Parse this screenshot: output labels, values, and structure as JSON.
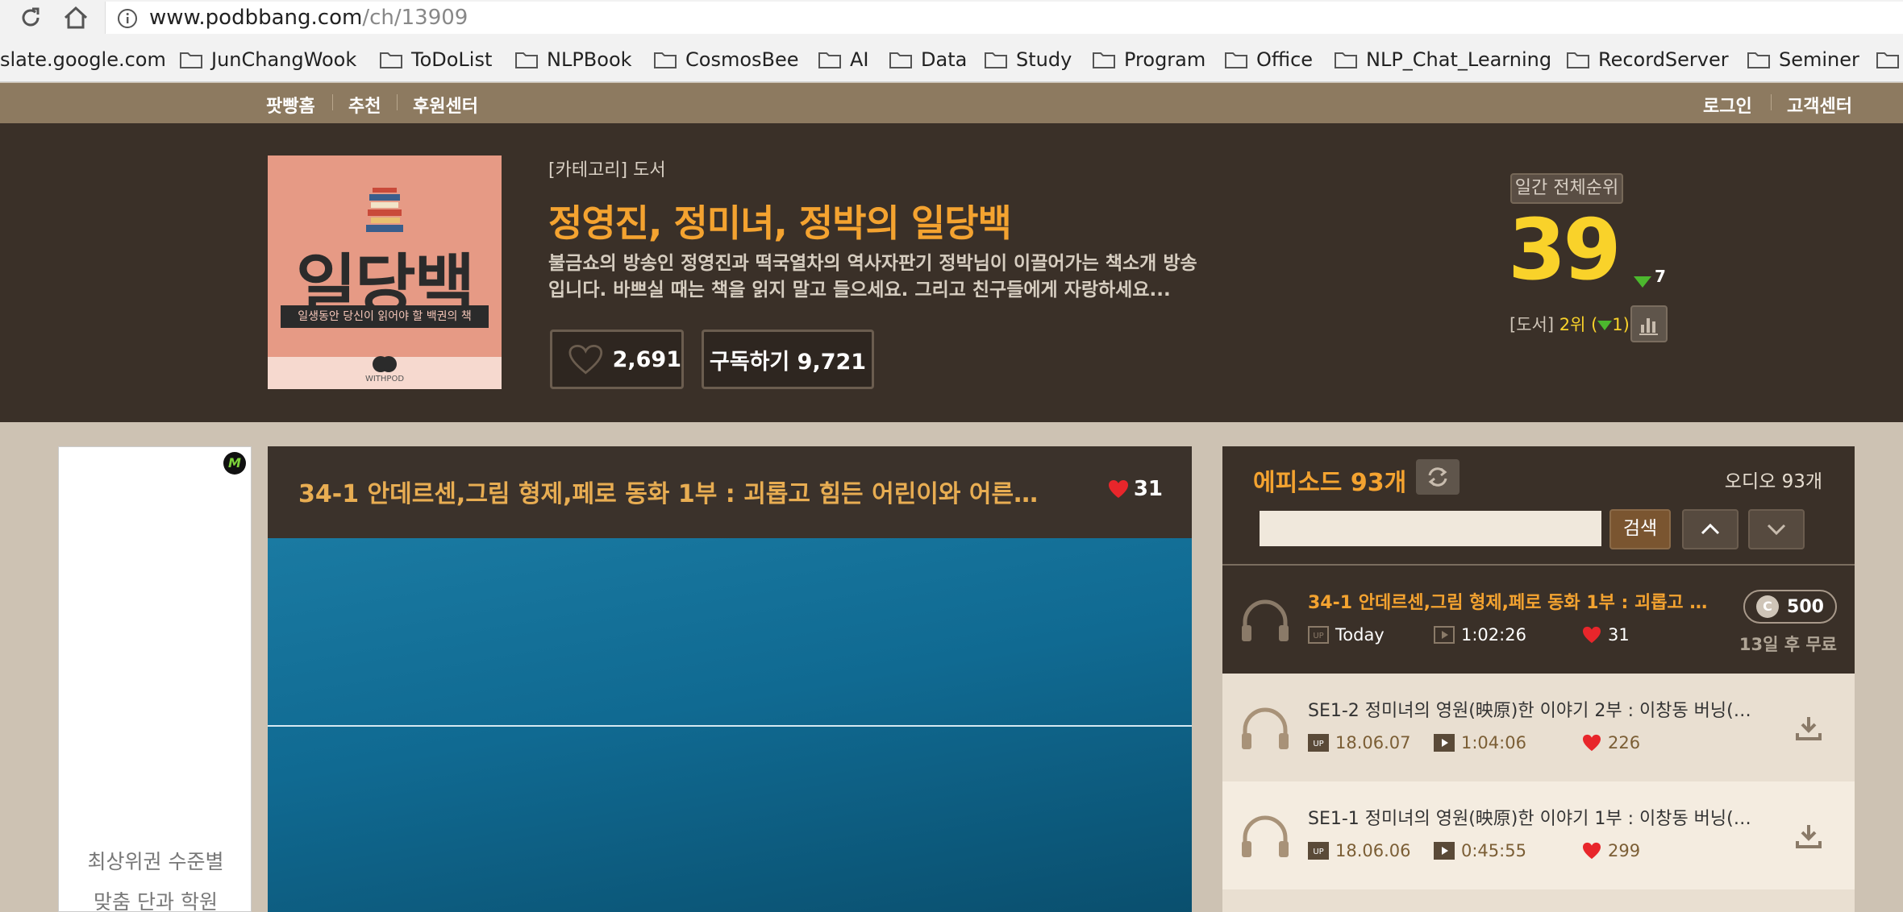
{
  "browser": {
    "url_host": "www.podbbang.com",
    "url_path": "/ch/13909",
    "bookmarks": [
      "slate.google.com",
      "JunChangWook",
      "ToDoList",
      "NLPBook",
      "CosmosBee",
      "AI",
      "Data",
      "Study",
      "Program",
      "Office",
      "NLP_Chat_Learning",
      "RecordServer",
      "Seminer"
    ]
  },
  "nav": {
    "home": "팟빵홈",
    "recommend": "추천",
    "sponsor": "후원센터",
    "login": "로그인",
    "support": "고객센터"
  },
  "channel": {
    "cover_title": "일당백",
    "cover_subtitle": "일생동안 당신이 읽어야 할 백권의 책",
    "cover_logo_text": "WITHPOD",
    "category": "[카테고리] 도서",
    "title": "정영진, 정미녀, 정박의 일당백",
    "description": "불금쇼의 방송인 정영진과 떡국열차의 역사자판기 정박님이 이끌어가는 책소개 방송입니다. 바쁘실 때는 책을 읽지 말고 들으세요. 그리고 친구들에게 자랑하세요...",
    "likes": "2,691",
    "subscribe_label": "구독하기 9,721"
  },
  "ranking": {
    "label": "일간 전체순위",
    "rank": "39",
    "change": "7",
    "category_prefix": "[도서] ",
    "category_rank": "2위",
    "category_paren_open": " (",
    "category_change": "1",
    "category_paren_close": ")"
  },
  "ad": {
    "badge": "M",
    "line1": "최상위권 수준별",
    "line2": "맞춤 단과 학원"
  },
  "player": {
    "title": "34-1 안데르센,그림 형제,페로 동화 1부 : 괴롭고 힘든 어린이와 어른에게 가…",
    "likes": "31"
  },
  "episodes": {
    "count_label": "에피소드 93개",
    "audio_count": "오디오 93개",
    "search_button": "검색",
    "items": [
      {
        "title": "34-1 안데르센,그림 형제,페로 동화 1부 : 괴롭고 …",
        "date": "Today",
        "duration": "1:02:26",
        "likes": "31",
        "price": "500",
        "free_label": "13일 후 무료"
      },
      {
        "title": "SE1-2 정미녀의 영원(映原)한 이야기 2부 : 이창동 버닝(B…",
        "date": "18.06.07",
        "duration": "1:04:06",
        "likes": "226"
      },
      {
        "title": "SE1-1 정미녀의 영원(映原)한 이야기 1부 : 이창동 버닝(B…",
        "date": "18.06.06",
        "duration": "0:45:55",
        "likes": "299"
      }
    ]
  }
}
